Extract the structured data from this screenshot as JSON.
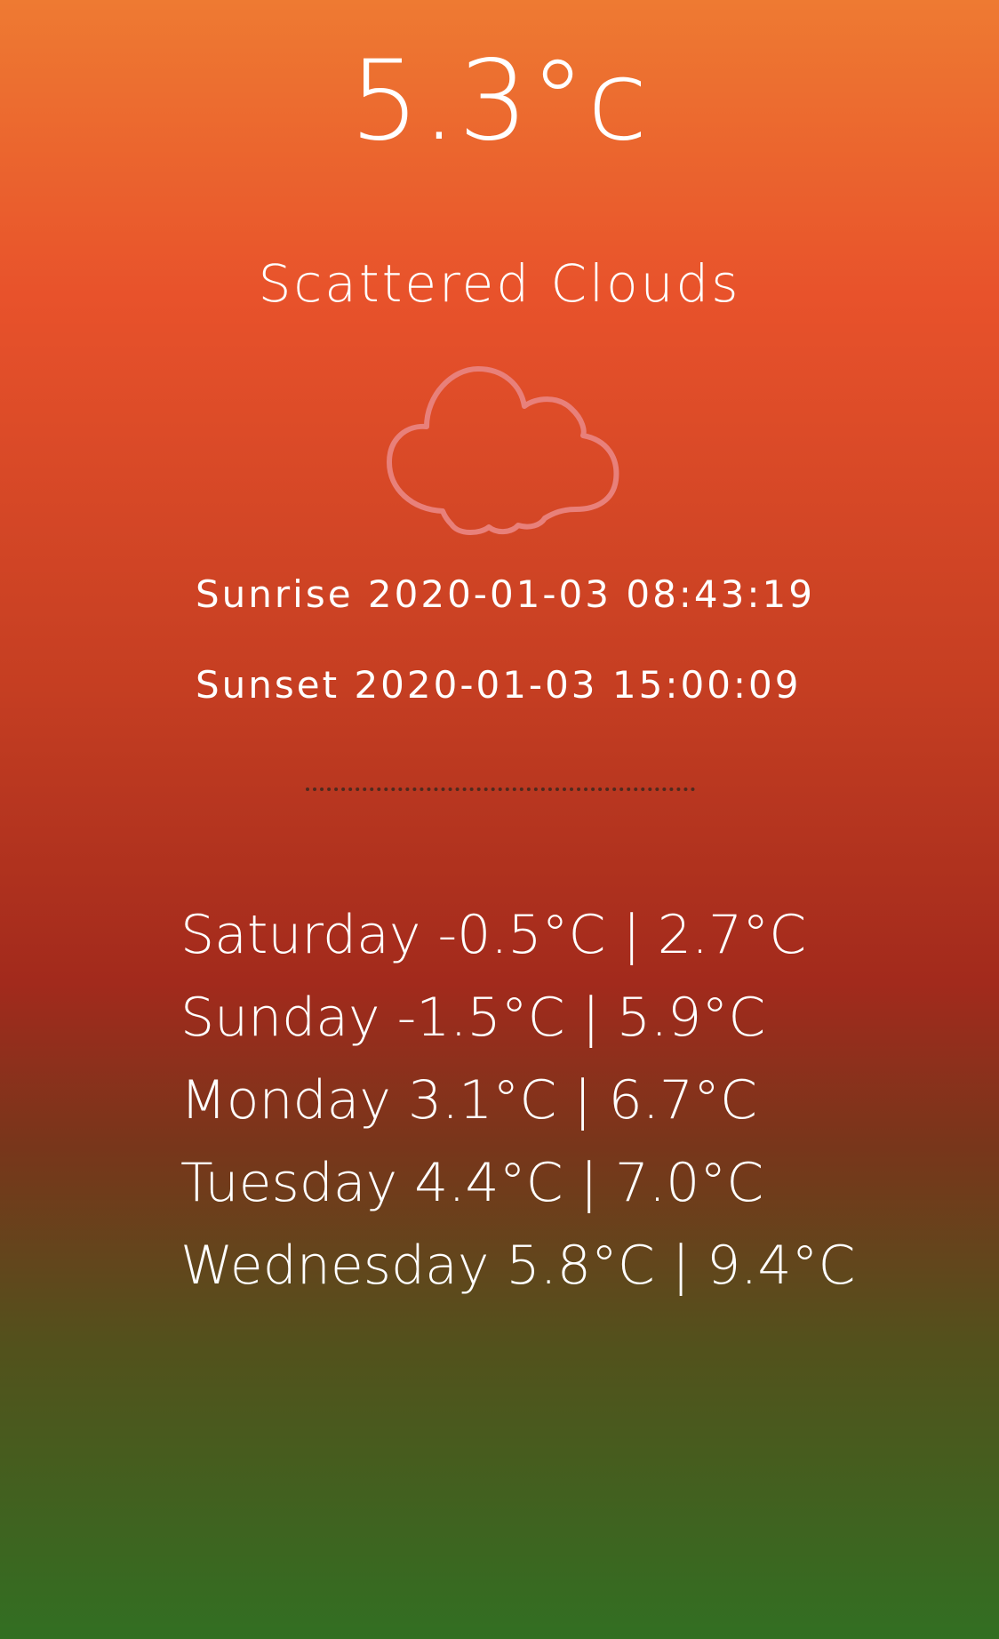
{
  "current": {
    "temperature": "5.3°c",
    "condition": "Scattered Clouds",
    "icon": "cloud-icon",
    "sunrise": "Sunrise 2020-01-03 08:43:19",
    "sunset": "Sunset 2020-01-03 15:00:09"
  },
  "forecast": [
    {
      "text": "Saturday -0.5°C | 2.7°C"
    },
    {
      "text": "Sunday -1.5°C | 5.9°C"
    },
    {
      "text": "Monday 3.1°C | 6.7°C"
    },
    {
      "text": "Tuesday 4.4°C | 7.0°C"
    },
    {
      "text": "Wednesday 5.8°C | 9.4°C"
    }
  ],
  "colors": {
    "gradient_top": "#ee7a32",
    "gradient_mid": "#a22a1c",
    "gradient_bottom": "#326f22",
    "icon_stroke": "#e8807a",
    "text": "#ffffff"
  }
}
